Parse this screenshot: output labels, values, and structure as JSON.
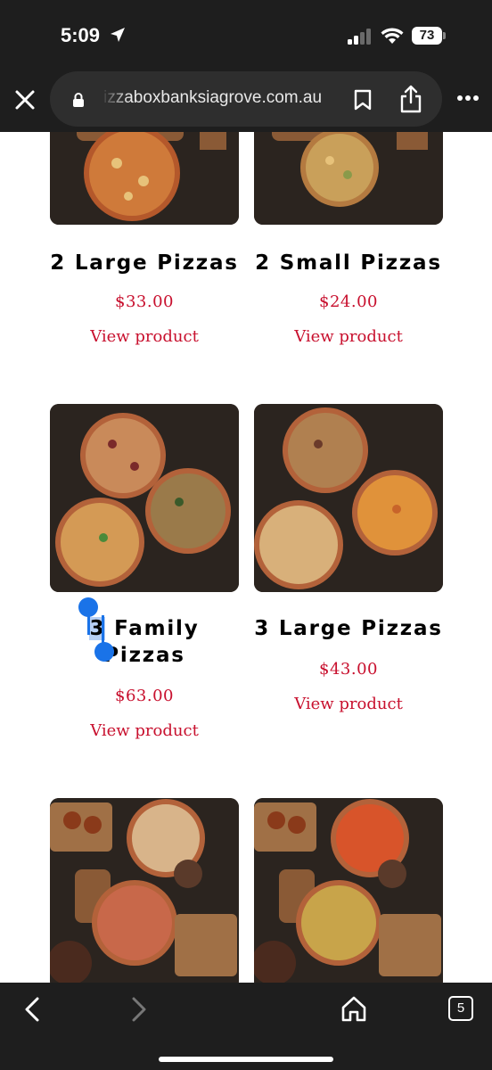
{
  "status_bar": {
    "time": "5:09",
    "battery": "73"
  },
  "browser": {
    "url": "izzaboxbanksiagrove.com.au",
    "tab_count": "5"
  },
  "products": [
    {
      "name": "2 Large Pizzas",
      "price": "$33.00",
      "link": "View product"
    },
    {
      "name": "2 Small Pizzas",
      "price": "$24.00",
      "link": "View product"
    },
    {
      "name_part1": "3",
      "name_part2": " Family",
      "name_line2": "Pizzas",
      "price": "$63.00",
      "link": "View product"
    },
    {
      "name": "3 Large Pizzas",
      "price": "$43.00",
      "link": "View product"
    }
  ],
  "colors": {
    "price": "#c8102e",
    "chrome": "#1e1e1e",
    "selection": "#1a73e8"
  },
  "icons": [
    "location-arrow-icon",
    "signal-icon",
    "wifi-icon",
    "close-icon",
    "lock-icon",
    "bookmark-icon",
    "share-icon",
    "more-icon",
    "back-icon",
    "forward-icon",
    "home-icon",
    "tabs-icon"
  ]
}
